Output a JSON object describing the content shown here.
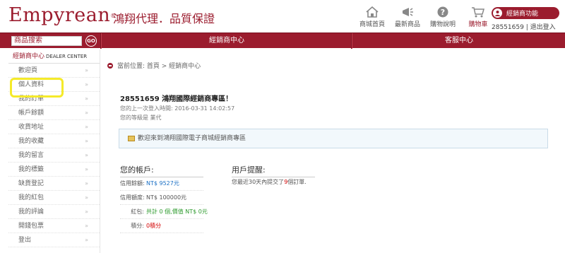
{
  "brand": {
    "name": "Empyrean",
    "reg": "®",
    "tagline": "鴻翔代理．品質保證",
    "color": "#9b1c2e"
  },
  "topnav": [
    {
      "label": "商城首頁",
      "icon": "home-icon"
    },
    {
      "label": "最新商品",
      "icon": "megaphone-icon"
    },
    {
      "label": "購物說明",
      "icon": "question-icon"
    },
    {
      "label": "購物車",
      "icon": "cart-icon"
    }
  ],
  "member": {
    "badge": "經銷商功能",
    "id": "28551659",
    "sep": "|",
    "logout": "退出登入"
  },
  "searchbar": {
    "value": "商品搜索",
    "go": "GO"
  },
  "bar": {
    "dealer_center": "經銷商中心",
    "service_center": "客服中心"
  },
  "sidebar": {
    "title": "經銷商中心",
    "title_en": "DEALER CENTER",
    "items": [
      "歡迎頁",
      "個人資料",
      "我的訂單",
      "帳戶餘額",
      "收貨地址",
      "我的收藏",
      "我的留言",
      "我的標籤",
      "缺貨登記",
      "我的紅包",
      "我的評論",
      "開錢包票",
      "登出"
    ]
  },
  "breadcrumb": "當前位置: 首頁 > 經銷商中心",
  "welcome": {
    "who": "28551659 鴻翔國際經銷商專區！",
    "last_login": "您的上一次登入時間: 2016-03-31 14:02:57",
    "level": "您的等級是 業代"
  },
  "notice": "歡迎來到鴻翔國際電子商城經銷商專區",
  "account": {
    "title": "您的帳戶:",
    "rows": [
      {
        "k": "信用餘額:",
        "v": "NT$ 9527元",
        "color": "blue"
      },
      {
        "k": "信用額度:",
        "v": "NT$ 100000元",
        "color": ""
      },
      {
        "k": "紅包:",
        "v": "共計 0 個,價值 NT$ 0元",
        "color": "green"
      },
      {
        "k": "積分:",
        "v": "0積分",
        "color": "red"
      }
    ]
  },
  "reminder": {
    "title": "用戶提醒:",
    "pre": "您最近30天內提交了",
    "count": "9",
    "post": "個訂單."
  }
}
